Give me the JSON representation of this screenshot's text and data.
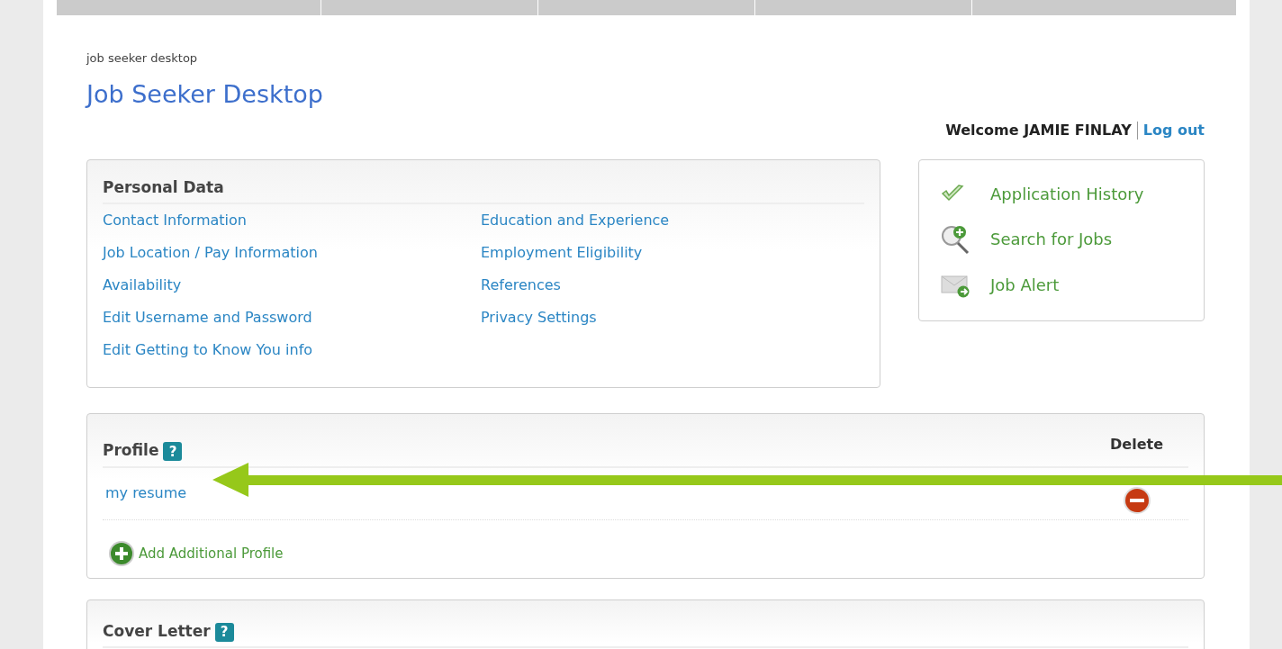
{
  "breadcrumb": "job seeker desktop",
  "page_title": "Job Seeker Desktop",
  "welcome": {
    "text": "Welcome JAMIE FINLAY",
    "logout": "Log out"
  },
  "personal_data": {
    "title": "Personal Data",
    "links_left": [
      "Contact Information",
      "Job Location / Pay Information",
      "Availability",
      "Edit Username and Password",
      "Edit Getting to Know You info"
    ],
    "links_right": [
      "Education and Experience",
      "Employment Eligibility",
      "References",
      "Privacy Settings"
    ]
  },
  "quick_links": [
    {
      "kind": "check",
      "label": "Application History"
    },
    {
      "kind": "search",
      "label": "Search for Jobs"
    },
    {
      "kind": "mail",
      "label": "Job Alert"
    }
  ],
  "profile": {
    "title": "Profile",
    "help": "?",
    "delete_header": "Delete",
    "items": [
      {
        "name": "my resume"
      }
    ],
    "add_label": "Add Additional Profile"
  },
  "cover_letter": {
    "title": "Cover Letter",
    "help": "?"
  }
}
